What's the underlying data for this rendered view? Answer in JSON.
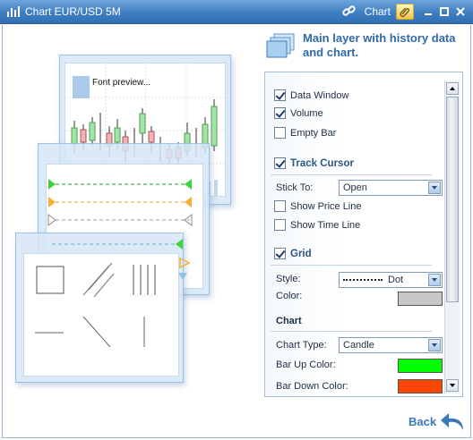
{
  "window": {
    "title": "Chart EUR/USD 5M",
    "mode_label": "Chart"
  },
  "icons": [
    "app-chart-icon",
    "link-icon",
    "paperclip-icon",
    "minimize-icon",
    "maximize-icon",
    "close-icon",
    "layers-icon",
    "back-arrow-icon"
  ],
  "header": {
    "title": "Main layer with history data and chart."
  },
  "preview": {
    "font_preview": "Font preview..."
  },
  "settings": {
    "data_window": {
      "label": "Data Window",
      "checked": true
    },
    "volume": {
      "label": "Volume",
      "checked": true
    },
    "empty_bar": {
      "label": "Empty Bar",
      "checked": false
    },
    "track_cursor": {
      "label": "Track Cursor",
      "checked": true
    },
    "stick_to": {
      "label": "Stick To:",
      "value": "Open"
    },
    "show_price_line": {
      "label": "Show Price Line",
      "checked": false
    },
    "show_time_line": {
      "label": "Show Time Line",
      "checked": false
    },
    "grid": {
      "label": "Grid",
      "checked": true
    },
    "style": {
      "label": "Style:",
      "value": "Dot"
    },
    "color": {
      "label": "Color:",
      "value": "#c8c8c8"
    },
    "chart_section": "Chart",
    "chart_type": {
      "label": "Chart Type:",
      "value": "Candle"
    },
    "bar_up_color": {
      "label": "Bar Up Color:",
      "value": "#00ff00"
    },
    "bar_down_color": {
      "label": "Bar Down Color:",
      "value": "#ff4500"
    }
  },
  "footer": {
    "back_label": "Back"
  },
  "colors": {
    "accent": "#3a78b8",
    "titlebar": "#3f7ec2"
  }
}
